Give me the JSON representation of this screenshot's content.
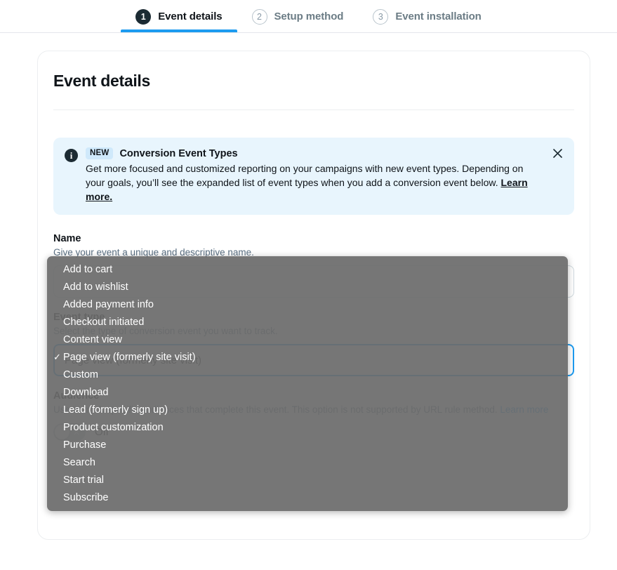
{
  "steps": [
    {
      "num": "1",
      "label": "Event details",
      "state": "active"
    },
    {
      "num": "2",
      "label": "Setup method",
      "state": "inactive"
    },
    {
      "num": "3",
      "label": "Event installation",
      "state": "inactive"
    }
  ],
  "card": {
    "title": "Event details"
  },
  "banner": {
    "icon": "info-icon",
    "badge": "NEW",
    "title": "Conversion Event Types",
    "body": "Get more focused and customized reporting on your campaigns with new event types. Depending on your goals, you’ll see the expanded list of event types when you add a conversion event below.",
    "link": "Learn more.",
    "close_icon": "close-icon",
    "background_color": "#e8f5fd",
    "badge_color": "#cfe9fb"
  },
  "fields": {
    "name": {
      "label": "Name",
      "hint": "Give your event a unique and descriptive name.",
      "value": "",
      "placeholder": ""
    },
    "event_type": {
      "label": "Event type",
      "hint": "Select the type of conversion event you want to track.",
      "value": "Page view (formerly site visit)",
      "placeholder": ""
    },
    "audience": {
      "label": "Audience",
      "hint_prefix": "Use to track specific audiences that complete this event. This option is not supported by URL rule method.",
      "hint_link": "Learn more",
      "value": "",
      "placeholder": ""
    }
  },
  "toggle": {
    "state_label": "Off",
    "icon": "x-icon",
    "on": false
  },
  "dropdown": {
    "selected": "Page view (formerly site visit)",
    "check_icon": "check-icon",
    "background_color": "#6c6c6c",
    "options": [
      {
        "label": "Add to cart",
        "selected": false
      },
      {
        "label": "Add to wishlist",
        "selected": false
      },
      {
        "label": "Added payment info",
        "selected": false
      },
      {
        "label": "Checkout initiated",
        "selected": false
      },
      {
        "label": "Content view",
        "selected": false
      },
      {
        "label": "Page view (formerly site visit)",
        "selected": true
      },
      {
        "label": "Custom",
        "selected": false
      },
      {
        "label": "Download",
        "selected": false
      },
      {
        "label": "Lead (formerly sign up)",
        "selected": false
      },
      {
        "label": "Product customization",
        "selected": false
      },
      {
        "label": "Purchase",
        "selected": false
      },
      {
        "label": "Search",
        "selected": false
      },
      {
        "label": "Start trial",
        "selected": false
      },
      {
        "label": "Subscribe",
        "selected": false
      }
    ]
  },
  "colors": {
    "accent": "#1d9bf0",
    "text": "#0f1419",
    "muted": "#5b7083"
  }
}
